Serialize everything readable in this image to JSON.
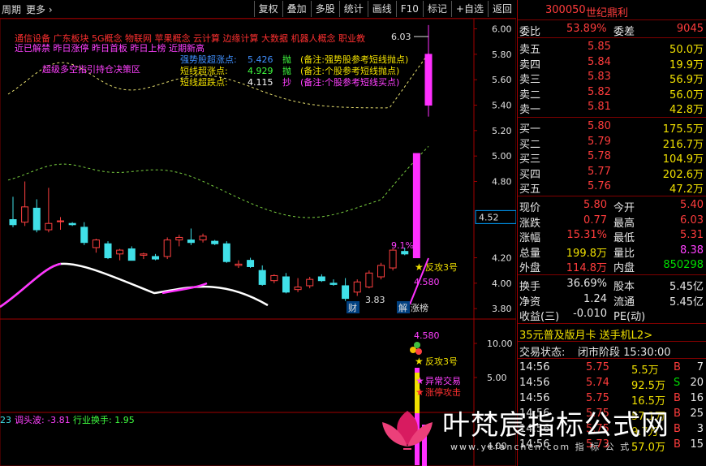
{
  "topbar": {
    "period": "周期",
    "more": "更多",
    "buttons": [
      "复权",
      "叠加",
      "多股",
      "统计",
      "画线",
      "F10",
      "标记",
      "+自选",
      "返回"
    ]
  },
  "stock": {
    "code": "300050",
    "name": "世纪鼎利"
  },
  "quote": {
    "weibi_label": "委比",
    "weibi": "53.89%",
    "weicha_label": "委差",
    "weicha": "9045",
    "sell": [
      {
        "label": "卖五",
        "price": "5.85",
        "vol": "50.0万"
      },
      {
        "label": "卖四",
        "price": "5.84",
        "vol": "19.9万"
      },
      {
        "label": "卖三",
        "price": "5.83",
        "vol": "56.9万"
      },
      {
        "label": "卖二",
        "price": "5.82",
        "vol": "56.0万"
      },
      {
        "label": "卖一",
        "price": "5.81",
        "vol": "42.8万"
      }
    ],
    "buy": [
      {
        "label": "买一",
        "price": "5.80",
        "vol": "175.5万"
      },
      {
        "label": "买二",
        "price": "5.79",
        "vol": "216.7万"
      },
      {
        "label": "买三",
        "price": "5.78",
        "vol": "104.9万"
      },
      {
        "label": "买四",
        "price": "5.77",
        "vol": "202.6万"
      },
      {
        "label": "买五",
        "price": "5.76",
        "vol": "47.2万"
      }
    ],
    "stats": [
      {
        "l1": "现价",
        "v1": "5.80",
        "l2": "今开",
        "v2": "5.40",
        "c1": "red",
        "c2": "red"
      },
      {
        "l1": "涨跌",
        "v1": "0.77",
        "l2": "最高",
        "v2": "6.03",
        "c1": "red",
        "c2": "red"
      },
      {
        "l1": "涨幅",
        "v1": "15.31%",
        "l2": "最低",
        "v2": "5.31",
        "c1": "red",
        "c2": "red"
      },
      {
        "l1": "总量",
        "v1": "199.8万",
        "l2": "量比",
        "v2": "8.38",
        "c1": "yellow",
        "c2": "magenta"
      },
      {
        "l1": "外盘",
        "v1": "114.8万",
        "l2": "内盘",
        "v2": "850298",
        "c1": "red",
        "c2": "green"
      }
    ],
    "stats2": [
      {
        "l1": "换手",
        "v1": "36.69%",
        "l2": "股本",
        "v2": "5.45亿"
      },
      {
        "l1": "净资",
        "v1": "1.24",
        "l2": "流通",
        "v2": "5.45亿"
      },
      {
        "l1": "收益(三)",
        "v1": "-0.010",
        "l2": "PE(动)",
        "v2": ""
      }
    ],
    "promo": "35元普及版月卡 送手机L2>",
    "status_label": "交易状态:",
    "status": "闭市阶段 15:30:00",
    "ticks": [
      {
        "time": "14:56",
        "price": "5.75",
        "vol": "5.5万",
        "side": "B",
        "n": "7"
      },
      {
        "time": "14:56",
        "price": "5.74",
        "vol": "92.5万",
        "side": "S",
        "n": "20"
      },
      {
        "time": "14:56",
        "price": "5.75",
        "vol": "16.5万",
        "side": "B",
        "n": "16"
      },
      {
        "time": "14:56",
        "price": "5.75",
        "vol": "57.1万",
        "side": "B",
        "n": "25"
      },
      {
        "time": "14:56",
        "price": "5.75",
        "vol": "9.7万",
        "side": "B",
        "n": "3"
      },
      {
        "time": "14:56",
        "price": "5.73",
        "vol": "57.0万",
        "side": "B",
        "n": "15"
      }
    ]
  },
  "chart": {
    "concepts_line1": "通信设备 广东板块 5G概念 物联网 苹果概念 云计算 边缘计算 大数据 机器人概念 职业教",
    "concepts_line2": "近已解禁 昨日涨停 昨日首板 昨日上榜 近期新高",
    "multi_space": "超级多空指引持仓决策区",
    "signals": [
      {
        "label": "强势股超涨点:",
        "value": "5.426",
        "tag": "抛",
        "note": "(备注:强势股参考短线抛点)"
      },
      {
        "label": "短线超涨点:",
        "value": "4.929",
        "tag": "抛",
        "note": "(备注:个股参考短线抛点)"
      },
      {
        "label": "短线超跌点:",
        "value": "4.115",
        "tag": "抄",
        "note": "(备注:个股参考短线买点)"
      }
    ],
    "price_ticks": [
      "6.00",
      "5.80",
      "5.60",
      "5.40",
      "5.20",
      "5.00",
      "4.80",
      "4.20",
      "4.00",
      "3.80"
    ],
    "current_price_tag": "4.52",
    "high_label": "6.03",
    "low_label": "3.83",
    "pct_label": "9.1%",
    "fangong": "反攻3号",
    "level_4580": "4.580",
    "cai": "财",
    "jie": "解",
    "zhangbang": "涨榜",
    "lower_ticks": [
      "10.00",
      "5.00"
    ],
    "lower_panel_label": "23",
    "tiaotoubo": "调头波: -3.81",
    "hangye": "行业换手: 1.95",
    "lower_4580": "4.580",
    "fangong2": "反攻3号",
    "yichang": "异常交易",
    "zhangting": "涨停攻击",
    "lower_tick_bottom": "4.00"
  },
  "watermark": {
    "text": "叶梵宸指标公式网",
    "sub": "www.yefanchen.com   指 标 公 式"
  },
  "chart_data": {
    "type": "candlestick",
    "ylim": [
      3.75,
      6.08
    ],
    "candles": [
      {
        "o": 4.5,
        "h": 4.68,
        "l": 4.44,
        "c": 4.46
      },
      {
        "o": 4.48,
        "h": 4.8,
        "l": 4.45,
        "c": 4.6
      },
      {
        "o": 4.59,
        "h": 4.66,
        "l": 4.4,
        "c": 4.42
      },
      {
        "o": 4.42,
        "h": 4.75,
        "l": 4.4,
        "c": 4.47
      },
      {
        "o": 4.49,
        "h": 4.52,
        "l": 4.42,
        "c": 4.49
      },
      {
        "o": 4.47,
        "h": 4.48,
        "l": 4.45,
        "c": 4.46
      },
      {
        "o": 4.44,
        "h": 4.48,
        "l": 4.3,
        "c": 4.32
      },
      {
        "o": 4.28,
        "h": 4.35,
        "l": 4.24,
        "c": 4.34
      },
      {
        "o": 4.31,
        "h": 4.33,
        "l": 4.19,
        "c": 4.2
      },
      {
        "o": 4.23,
        "h": 4.27,
        "l": 4.18,
        "c": 4.26
      },
      {
        "o": 4.27,
        "h": 4.29,
        "l": 4.18,
        "c": 4.18
      },
      {
        "o": 4.22,
        "h": 4.24,
        "l": 4.19,
        "c": 4.23
      },
      {
        "o": 4.21,
        "h": 4.23,
        "l": 4.18,
        "c": 4.19
      },
      {
        "o": 4.21,
        "h": 4.36,
        "l": 4.19,
        "c": 4.34
      },
      {
        "o": 4.34,
        "h": 4.38,
        "l": 4.29,
        "c": 4.36
      },
      {
        "o": 4.34,
        "h": 4.43,
        "l": 4.3,
        "c": 4.32
      },
      {
        "o": 4.34,
        "h": 4.39,
        "l": 4.32,
        "c": 4.37
      },
      {
        "o": 4.33,
        "h": 4.34,
        "l": 4.3,
        "c": 4.31
      },
      {
        "o": 4.31,
        "h": 4.33,
        "l": 4.16,
        "c": 4.17
      },
      {
        "o": 4.14,
        "h": 4.18,
        "l": 4.12,
        "c": 4.15
      },
      {
        "o": 4.18,
        "h": 4.2,
        "l": 4.12,
        "c": 4.13
      },
      {
        "o": 4.1,
        "h": 4.14,
        "l": 3.98,
        "c": 3.99
      },
      {
        "o": 4.02,
        "h": 4.07,
        "l": 4.0,
        "c": 4.06
      },
      {
        "o": 4.05,
        "h": 4.08,
        "l": 3.92,
        "c": 3.93
      },
      {
        "o": 3.95,
        "h": 4.04,
        "l": 3.93,
        "c": 3.97
      },
      {
        "o": 3.98,
        "h": 4.05,
        "l": 3.96,
        "c": 4.03
      },
      {
        "o": 4.05,
        "h": 4.07,
        "l": 4.01,
        "c": 4.02
      },
      {
        "o": 4.0,
        "h": 4.03,
        "l": 3.98,
        "c": 3.99
      },
      {
        "o": 3.98,
        "h": 4.04,
        "l": 3.86,
        "c": 3.88
      },
      {
        "o": 3.93,
        "h": 4.03,
        "l": 3.9,
        "c": 4.01
      },
      {
        "o": 3.97,
        "h": 4.1,
        "l": 3.96,
        "c": 4.08
      },
      {
        "o": 4.05,
        "h": 4.16,
        "l": 4.03,
        "c": 4.14
      },
      {
        "o": 4.12,
        "h": 4.27,
        "l": 4.1,
        "c": 4.26
      },
      {
        "o": 4.25,
        "h": 4.28,
        "l": 4.22,
        "c": 4.23
      },
      {
        "o": 4.2,
        "h": 5.02,
        "l": 4.2,
        "c": 5.02
      },
      {
        "o": 5.4,
        "h": 6.03,
        "l": 5.31,
        "c": 5.8
      }
    ]
  }
}
